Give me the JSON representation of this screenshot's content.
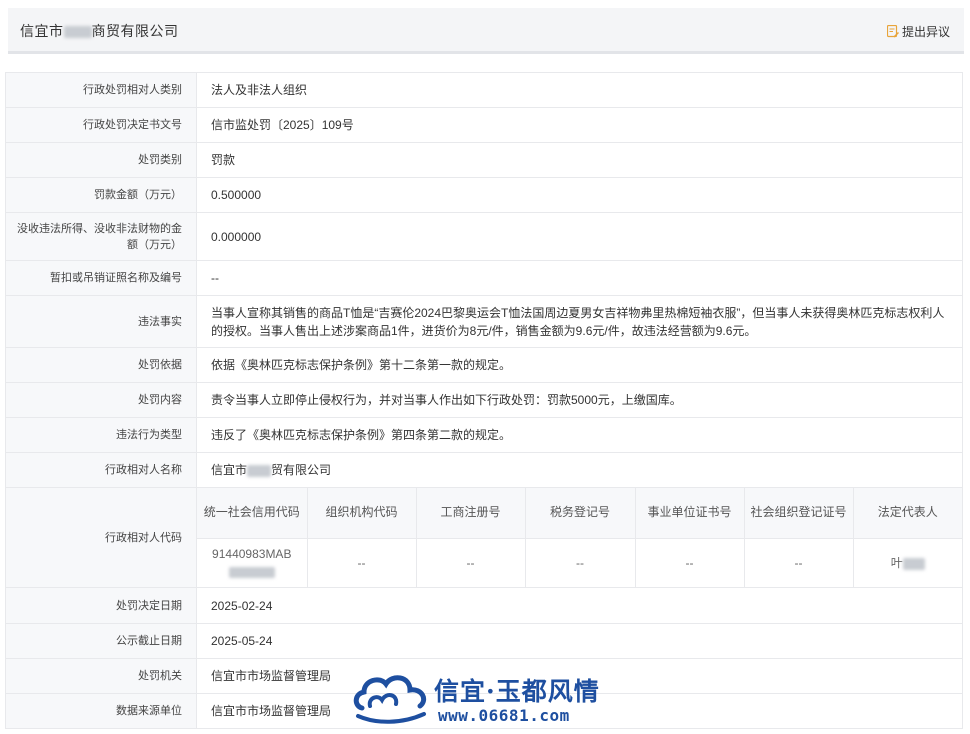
{
  "header": {
    "title_prefix": "信宜市",
    "title_suffix": "商贸有限公司",
    "objection_label": "提出异议",
    "objection_icon": "document-edit-icon"
  },
  "rows": [
    {
      "label": "行政处罚相对人类别",
      "value": "法人及非法人组织"
    },
    {
      "label": "行政处罚决定书文号",
      "value": "信市监处罚〔2025〕109号"
    },
    {
      "label": "处罚类别",
      "value": "罚款"
    },
    {
      "label": "罚款金额（万元）",
      "value": "0.500000"
    },
    {
      "label": "没收违法所得、没收非法财物的金额（万元）",
      "value": "0.000000"
    },
    {
      "label": "暂扣或吊销证照名称及编号",
      "value": "--"
    },
    {
      "label": "违法事实",
      "value": "当事人宣称其销售的商品T恤是“吉赛伦2024巴黎奥运会T恤法国周边夏男女吉祥物弗里热棉短袖衣服”，但当事人未获得奥林匹克标志权利人的授权。当事人售出上述涉案商品1件，进货价为8元/件，销售金额为9.6元/件，故违法经营额为9.6元。"
    },
    {
      "label": "处罚依据",
      "value": "依据《奥林匹克标志保护条例》第十二条第一款的规定。"
    },
    {
      "label": "处罚内容",
      "value": "责令当事人立即停止侵权行为，并对当事人作出如下行政处罚：罚款5000元，上缴国库。"
    },
    {
      "label": "违法行为类型",
      "value": "违反了《奥林匹克标志保护条例》第四条第二款的规定。"
    }
  ],
  "party_name": {
    "label": "行政相对人名称",
    "value_prefix": "信宜市",
    "value_suffix": "贸有限公司"
  },
  "party_codes": {
    "label": "行政相对人代码",
    "headers": [
      "统一社会信用代码",
      "组织机构代码",
      "工商注册号",
      "税务登记号",
      "事业单位证书号",
      "社会组织登记证号",
      "法定代表人"
    ],
    "values": [
      "91440983MAB",
      "--",
      "--",
      "--",
      "--",
      "--",
      "叶"
    ]
  },
  "tail_rows": [
    {
      "label": "处罚决定日期",
      "value": "2025-02-24"
    },
    {
      "label": "公示截止日期",
      "value": "2025-05-24"
    },
    {
      "label": "处罚机关",
      "value": "信宜市市场监督管理局"
    },
    {
      "label": "数据来源单位",
      "value": "信宜市市场监督管理局"
    }
  ],
  "watermark": {
    "text": "信宜·玉都风情",
    "url": "www.06681.com"
  }
}
